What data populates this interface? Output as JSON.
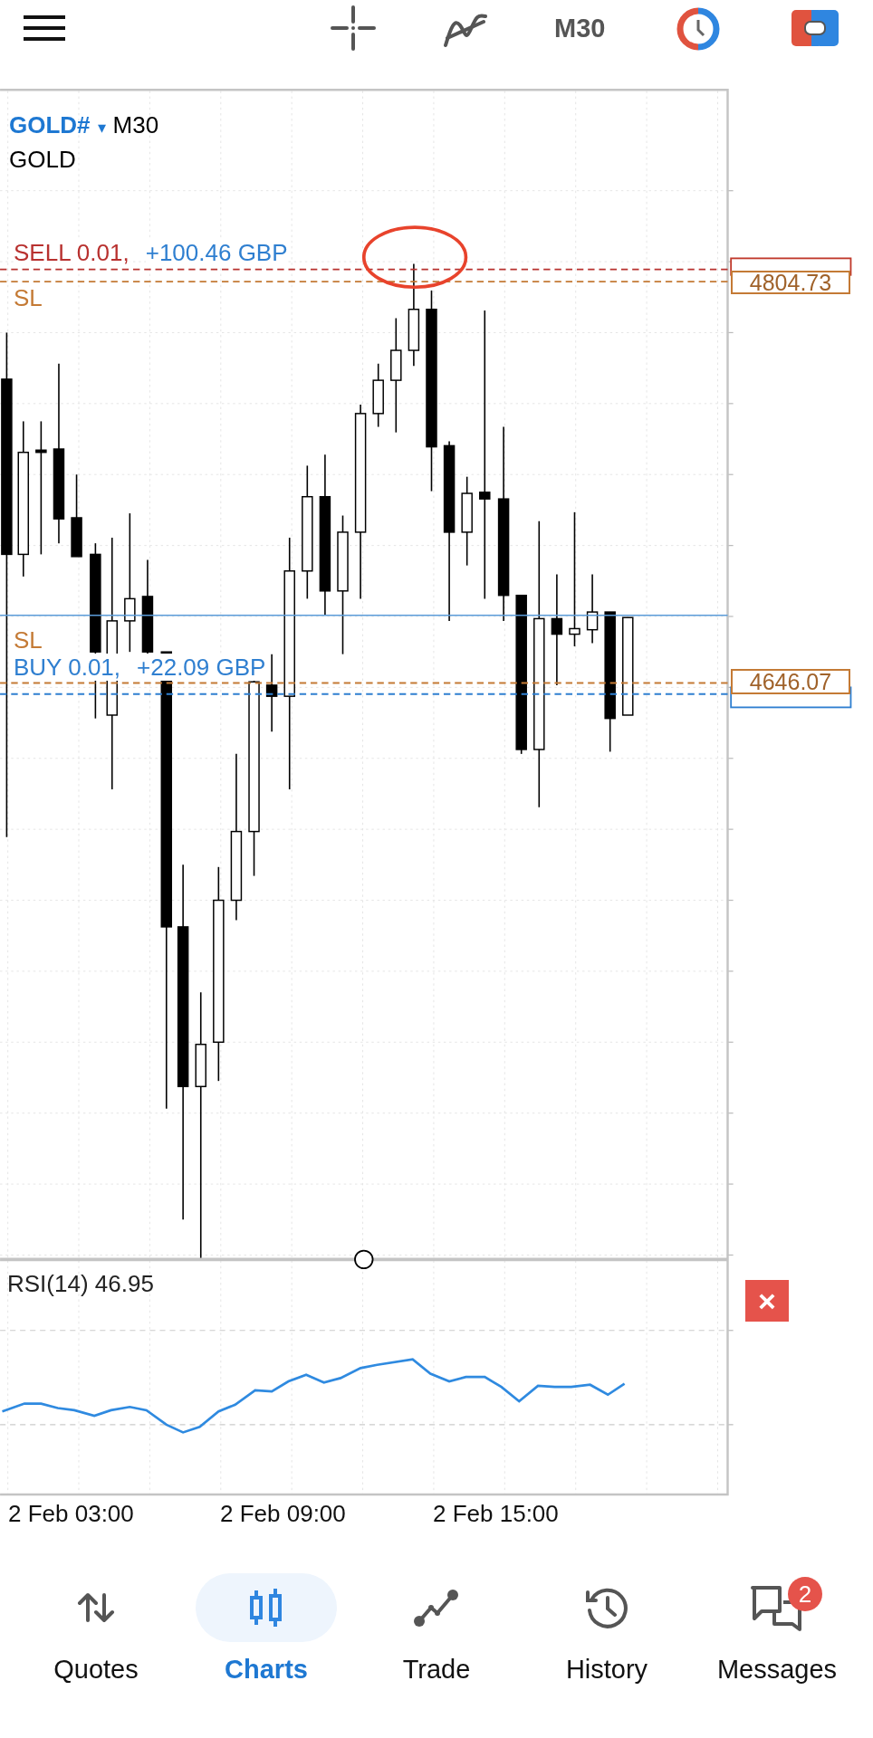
{
  "toolbar": {
    "timeframe": "M30"
  },
  "chart": {
    "symbol": "GOLD#",
    "dropdown": "▾",
    "timeframe": "M30",
    "description": "GOLD",
    "orders": [
      {
        "kind": "sell",
        "label": "SELL 0.01,",
        "profit": "+100.46 GBP",
        "sl_label": "SL",
        "sl_price": "4804.73"
      },
      {
        "kind": "buy",
        "label": "BUY 0.01,",
        "profit": "+22.09 GBP",
        "sl_label": "SL",
        "sl_price": "4646.07"
      }
    ],
    "indicator": {
      "label": "RSI(14) 46.95",
      "close": "×"
    },
    "time_labels": [
      "2 Feb 03:00",
      "2 Feb 09:00",
      "2 Feb 15:00"
    ]
  },
  "nav": [
    {
      "label": "Quotes",
      "selected": false
    },
    {
      "label": "Charts",
      "selected": true
    },
    {
      "label": "Trade",
      "selected": false
    },
    {
      "label": "History",
      "selected": false
    },
    {
      "label": "Messages",
      "selected": false,
      "badge": "2"
    }
  ]
}
